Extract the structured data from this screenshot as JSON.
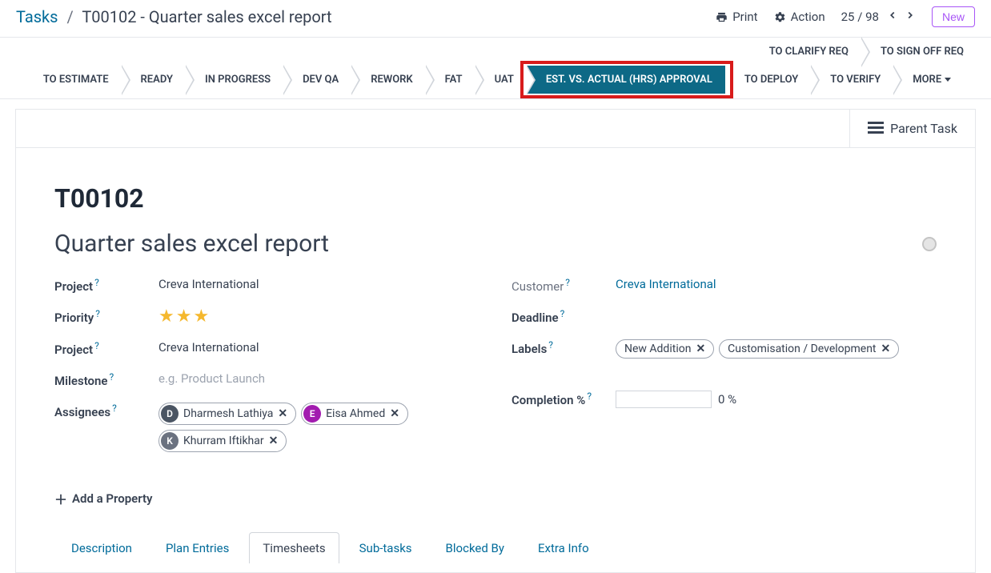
{
  "breadcrumb": {
    "root": "Tasks",
    "sep": "/",
    "item": "T00102 - Quarter sales excel report"
  },
  "topbar": {
    "print": "Print",
    "action": "Action",
    "pager": "25 / 98",
    "new": "New"
  },
  "stages_top": [
    "TO CLARIFY REQ",
    "TO SIGN OFF REQ"
  ],
  "stages_main": [
    "TO ESTIMATE",
    "READY",
    "IN PROGRESS",
    "DEV QA",
    "REWORK",
    "FAT",
    "UAT",
    "EST. VS. ACTUAL (HRS) APPROVAL",
    "TO DEPLOY",
    "TO VERIFY",
    "MORE"
  ],
  "parent_task": "Parent Task",
  "task": {
    "id": "T00102",
    "title": "Quarter sales excel report"
  },
  "left": {
    "project_label": "Project",
    "project_value": "Creva International",
    "priority_label": "Priority",
    "project2_label": "Project",
    "project2_value": "Creva International",
    "milestone_label": "Milestone",
    "milestone_placeholder": "e.g. Product Launch",
    "assignees_label": "Assignees"
  },
  "assignees": [
    {
      "name": "Dharmesh Lathiya",
      "avatar_bg": "#4b5563",
      "avatar_txt": "D"
    },
    {
      "name": "Eisa Ahmed",
      "avatar_bg": "#a21caf",
      "avatar_txt": "E"
    },
    {
      "name": "Khurram Iftikhar",
      "avatar_bg": "#6b7280",
      "avatar_txt": "K"
    }
  ],
  "right": {
    "customer_label": "Customer",
    "customer_value": "Creva International",
    "deadline_label": "Deadline",
    "labels_label": "Labels",
    "completion_label": "Completion %",
    "completion_suffix": "0 %"
  },
  "labels": [
    "New Addition",
    "Customisation / Development"
  ],
  "add_property": "Add a Property",
  "tabs": [
    "Description",
    "Plan Entries",
    "Timesheets",
    "Sub-tasks",
    "Blocked By",
    "Extra Info"
  ],
  "active_tab": 2
}
